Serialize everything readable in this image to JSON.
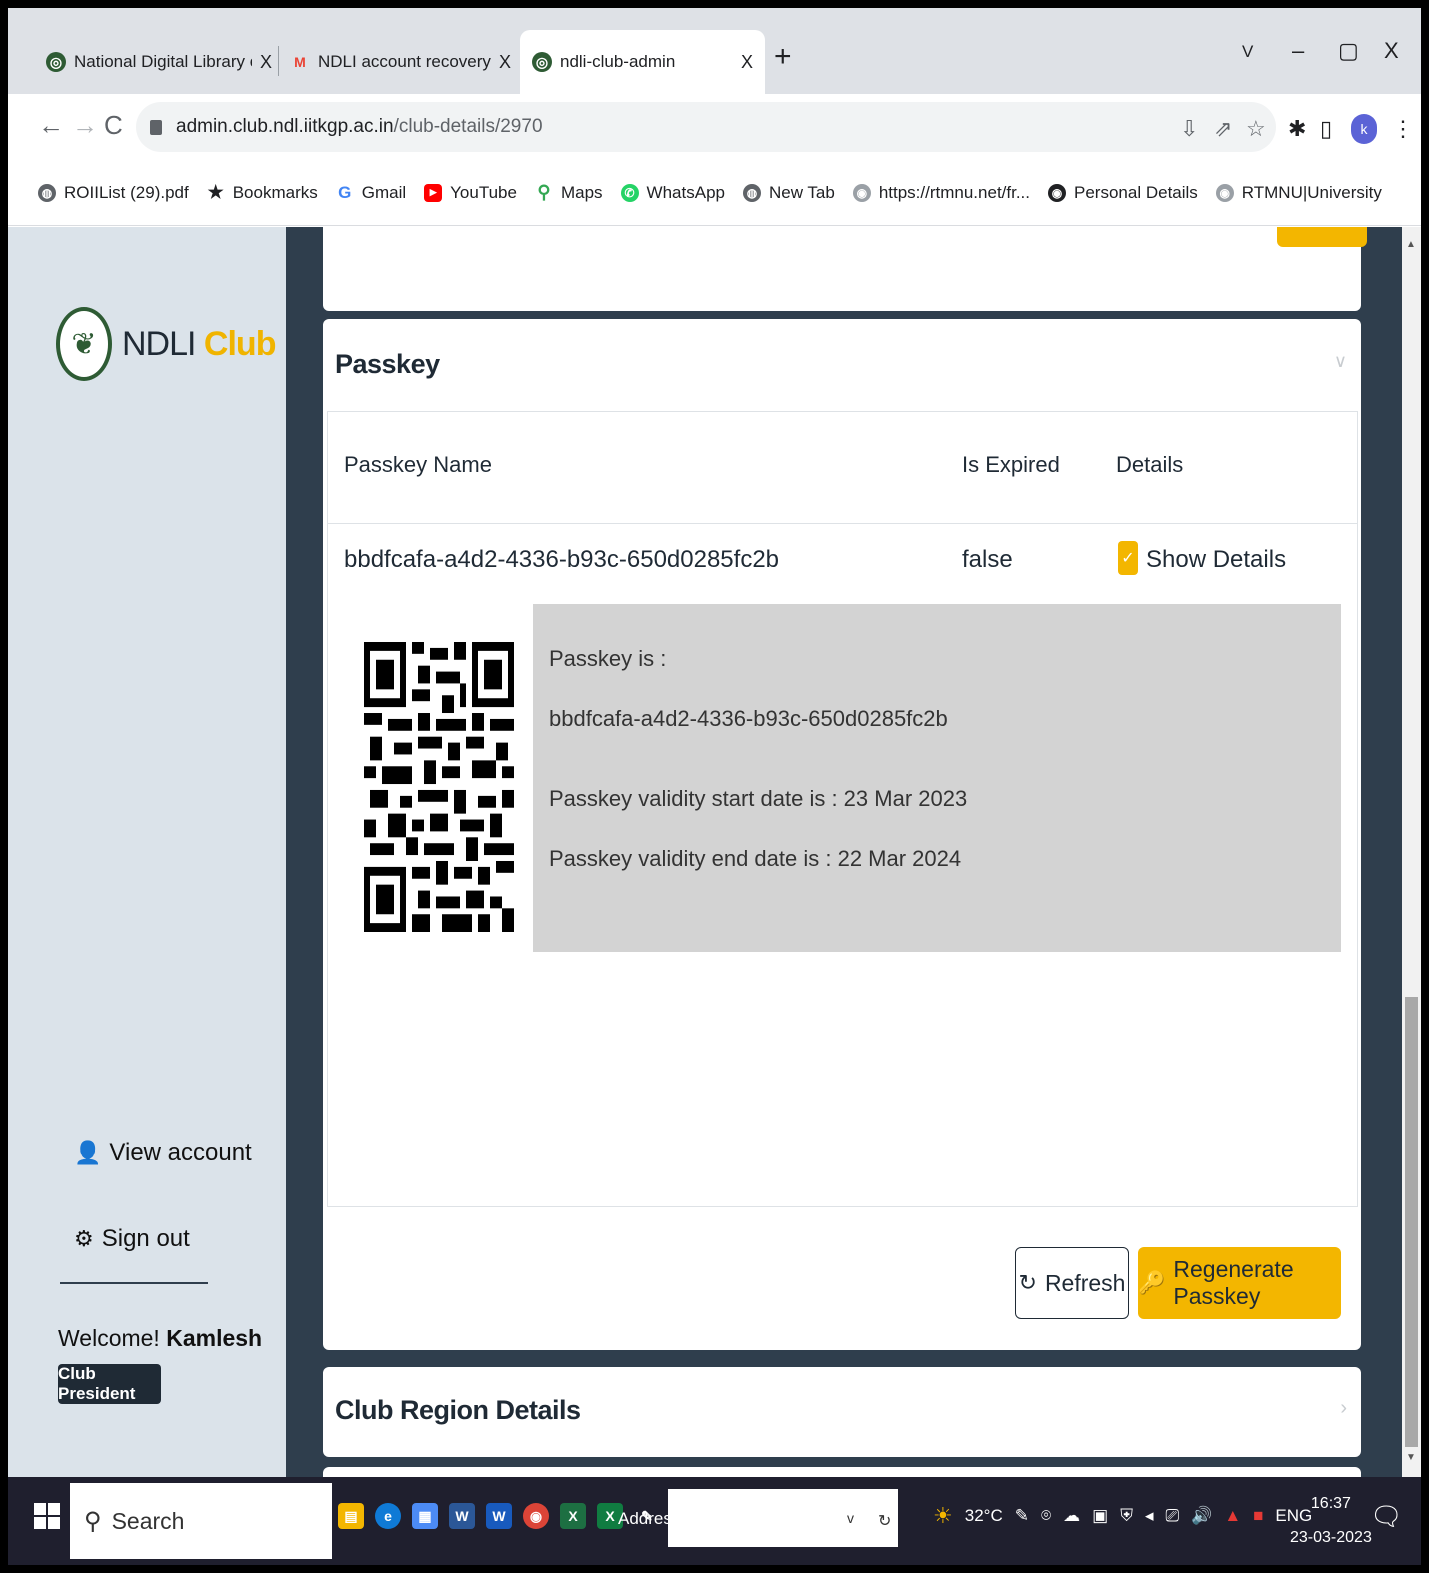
{
  "browser": {
    "tabs": [
      {
        "title": "National Digital Library of India",
        "close": "X"
      },
      {
        "title": "NDLI account recovery - scmmal",
        "close": "X"
      },
      {
        "title": "ndli-club-admin",
        "close": "X"
      }
    ],
    "new_tab": "+",
    "window_controls": {
      "dropdown": "V",
      "minimize": "–",
      "restore": "▢",
      "close": "X"
    },
    "url_host": "admin.club.ndl.iitkgp.ac.in",
    "url_path": "/club-details/2970",
    "profile_initial": "k",
    "bookmarks": [
      {
        "label": "ROIIList (29).pdf",
        "icon": "globe-icon",
        "color": "#5f6368"
      },
      {
        "label": "Bookmarks",
        "icon": "star-icon",
        "color": "#202124"
      },
      {
        "label": "Gmail",
        "icon": "google-icon",
        "color": "#4285f4"
      },
      {
        "label": "YouTube",
        "icon": "youtube-icon",
        "color": "#ff0000"
      },
      {
        "label": "Maps",
        "icon": "maps-icon",
        "color": "#34a853"
      },
      {
        "label": "WhatsApp",
        "icon": "whatsapp-icon",
        "color": "#25d366"
      },
      {
        "label": "New Tab",
        "icon": "globe-icon",
        "color": "#5f6368"
      },
      {
        "label": "https://rtmnu.net/fr...",
        "icon": "site-icon",
        "color": "#9aa0a6"
      },
      {
        "label": "Personal Details",
        "icon": "site-icon",
        "color": "#202124"
      },
      {
        "label": "RTMNU|University",
        "icon": "site-icon",
        "color": "#9aa0a6"
      }
    ]
  },
  "sidebar": {
    "logo_text": "NDLI",
    "logo_accent": "Club",
    "view_account": "View account",
    "sign_out": "Sign out",
    "welcome_prefix": "Welcome!",
    "user_name": "Kamlesh",
    "role": "Club President"
  },
  "passkey_card": {
    "title": "Passkey",
    "columns": [
      "Passkey Name",
      "Is Expired",
      "Details"
    ],
    "row": {
      "name": "bbdfcafa-a4d2-4336-b93c-650d0285fc2b",
      "is_expired": "false",
      "details_label": "Show Details",
      "details_checked": true
    },
    "details": {
      "passkey_label": "Passkey is :",
      "passkey_value": "bbdfcafa-a4d2-4336-b93c-650d0285fc2b",
      "start_label": "Passkey validity start date is : 23 Mar 2023",
      "end_label": "Passkey validity end date is : 22 Mar 2024"
    },
    "refresh_label": "Refresh",
    "regenerate_label": "Regenerate Passkey"
  },
  "region_card": {
    "title": "Club Region Details"
  },
  "colors": {
    "accent": "#f3b600",
    "dark": "#1f2a35",
    "page_bg": "#2f3e4d",
    "sidebar_bg": "#dbe3ea"
  },
  "taskbar": {
    "search_label": "Search",
    "address_label": "Address",
    "address_arrow": "v",
    "weather": "32°C",
    "language": "ENG",
    "time": "16:37",
    "date": "23-03-2023"
  }
}
